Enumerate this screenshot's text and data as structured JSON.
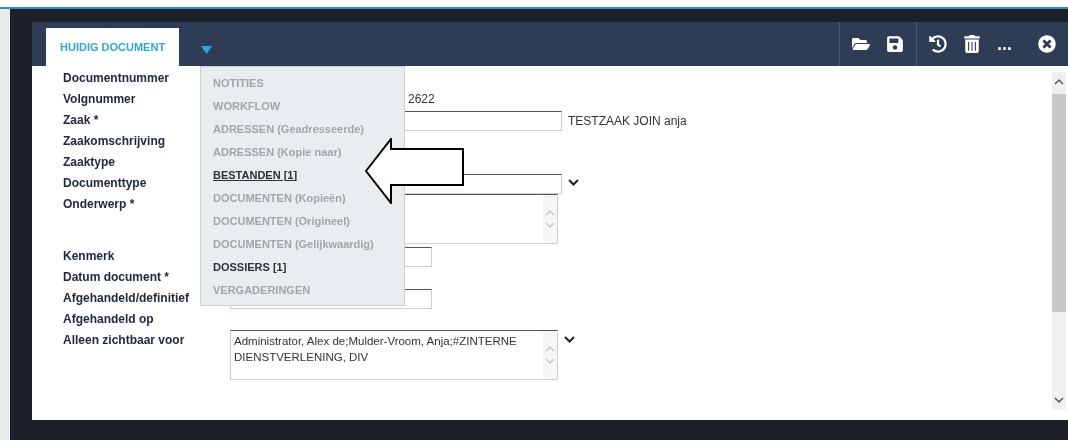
{
  "tabs": [
    {
      "label": "HUIDIG DOCUMENT",
      "selected": true
    }
  ],
  "toolbar": {
    "more_label": "..."
  },
  "menu": [
    {
      "label": "NOTITIES",
      "enabled": false,
      "selected": false
    },
    {
      "label": "WORKFLOW",
      "enabled": false,
      "selected": false
    },
    {
      "label": "ADRESSEN (Geadresseerde)",
      "enabled": false,
      "selected": false
    },
    {
      "label": "ADRESSEN (Kopie naar)",
      "enabled": false,
      "selected": false
    },
    {
      "label": "BESTANDEN [1]",
      "enabled": true,
      "selected": true
    },
    {
      "label": "DOCUMENTEN (Kopieën)",
      "enabled": false,
      "selected": false
    },
    {
      "label": "DOCUMENTEN (Origineel)",
      "enabled": false,
      "selected": false
    },
    {
      "label": "DOCUMENTEN (Gelijkwaardig)",
      "enabled": false,
      "selected": false
    },
    {
      "label": "DOSSIERS [1]",
      "enabled": true,
      "selected": false
    },
    {
      "label": "VERGADERINGEN",
      "enabled": false,
      "selected": false
    }
  ],
  "form": {
    "rows": [
      {
        "label": "Documentnummer",
        "kind": "empty"
      },
      {
        "label": "Volgnummer",
        "kind": "text",
        "value": "2622"
      },
      {
        "label": "Zaak *",
        "kind": "input",
        "note": "TESTZAAK JOIN anja"
      },
      {
        "label": "Zaakomschrijving",
        "kind": "empty"
      },
      {
        "label": "Zaaktype",
        "kind": "empty"
      },
      {
        "label": "Documenttype",
        "kind": "select"
      },
      {
        "label": "Onderwerp *",
        "kind": "textarea",
        "dropdown": false
      },
      {
        "label": "Kenmerk",
        "kind": "short"
      },
      {
        "label": "Datum document *",
        "kind": "empty"
      },
      {
        "label": "Afgehandeld/definitief",
        "kind": "short"
      },
      {
        "label": "Afgehandeld op",
        "kind": "empty"
      },
      {
        "label": "Alleen zichtbaar voor",
        "kind": "textarea",
        "dropdown": true,
        "value": "Administrator, Alex de;Mulder-Vroom, Anja;#ZINTERNE DIENSTVERLENING, DIV"
      }
    ]
  }
}
